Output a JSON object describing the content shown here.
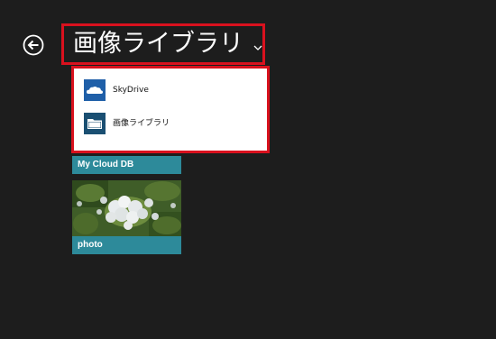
{
  "header": {
    "title": "画像ライブラリ"
  },
  "dropdown": {
    "items": [
      {
        "label": "SkyDrive",
        "icon": "cloud-icon"
      },
      {
        "label": "画像ライブラリ",
        "icon": "folder-icon"
      }
    ]
  },
  "tiles": [
    {
      "label": "My Cloud DB"
    },
    {
      "label": "photo"
    }
  ],
  "colors": {
    "background": "#1d1d1d",
    "highlight": "#d9111e",
    "tile_bar": "#2d8a9a",
    "icon_bg": "#1f5fa8"
  }
}
